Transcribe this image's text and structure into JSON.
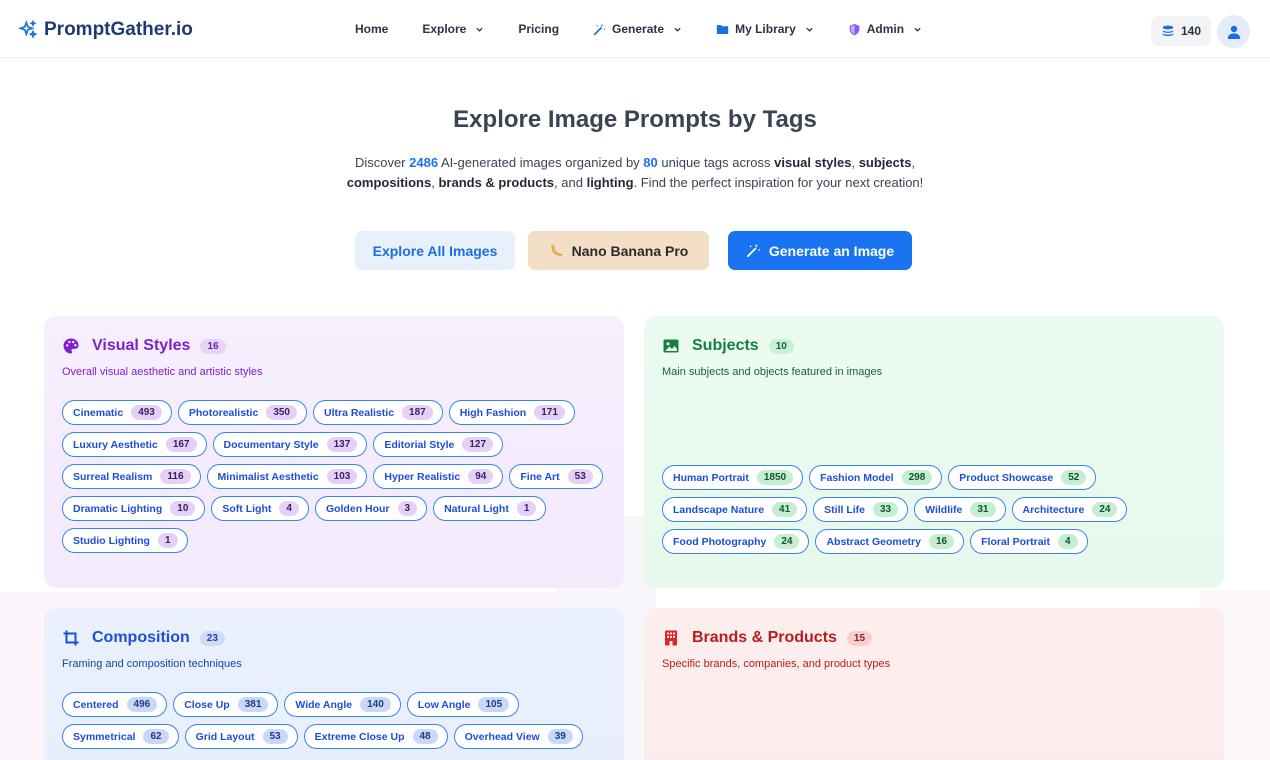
{
  "nav": {
    "logo": "PromptGather.io",
    "items": [
      {
        "label": "Home",
        "icon": "",
        "dropdown": false
      },
      {
        "label": "Explore",
        "icon": "",
        "dropdown": true
      },
      {
        "label": "Pricing",
        "icon": "",
        "dropdown": false
      },
      {
        "label": "Generate",
        "icon": "magic-wand-icon",
        "dropdown": true
      },
      {
        "label": "My Library",
        "icon": "folder-icon",
        "dropdown": true
      },
      {
        "label": "Admin",
        "icon": "shield-icon",
        "dropdown": true
      }
    ],
    "credits": "140"
  },
  "hero": {
    "title": "Explore Image Prompts by Tags",
    "desc": {
      "p1": "Discover ",
      "images_count": "2486",
      "p2": " AI-generated images organized by ",
      "tags_count": "80",
      "p3": " unique tags across ",
      "b1": "visual styles",
      "p4": ", ",
      "b2": "subjects",
      "p5": ",",
      "b3": "compositions",
      "p6": ", ",
      "b4": "brands & products",
      "p7": ", and ",
      "b5": "lighting",
      "p8": ". Find the perfect inspiration for your next creation!"
    },
    "buttons": {
      "explore": "Explore All Images",
      "banana": "Nano Banana Pro",
      "generate": "Generate an Image"
    }
  },
  "categories": {
    "visual": {
      "title": "Visual Styles",
      "count": "16",
      "desc": "Overall visual aesthetic and artistic styles",
      "icon": "palette-icon",
      "tags": [
        {
          "label": "Cinematic",
          "count": "493"
        },
        {
          "label": "Photorealistic",
          "count": "350"
        },
        {
          "label": "Ultra Realistic",
          "count": "187"
        },
        {
          "label": "High Fashion",
          "count": "171"
        },
        {
          "label": "Luxury Aesthetic",
          "count": "167"
        },
        {
          "label": "Documentary Style",
          "count": "137"
        },
        {
          "label": "Editorial Style",
          "count": "127"
        },
        {
          "label": "Surreal Realism",
          "count": "116"
        },
        {
          "label": "Minimalist Aesthetic",
          "count": "103"
        },
        {
          "label": "Hyper Realistic",
          "count": "94"
        },
        {
          "label": "Fine Art",
          "count": "53"
        },
        {
          "label": "Dramatic Lighting",
          "count": "10"
        },
        {
          "label": "Soft Light",
          "count": "4"
        },
        {
          "label": "Golden Hour",
          "count": "3"
        },
        {
          "label": "Natural Light",
          "count": "1"
        },
        {
          "label": "Studio Lighting",
          "count": "1"
        }
      ]
    },
    "subjects": {
      "title": "Subjects",
      "count": "10",
      "desc": "Main subjects and objects featured in images",
      "icon": "image-icon",
      "tags": [
        {
          "label": "Human Portrait",
          "count": "1850"
        },
        {
          "label": "Fashion Model",
          "count": "298"
        },
        {
          "label": "Product Showcase",
          "count": "52"
        },
        {
          "label": "Landscape Nature",
          "count": "41"
        },
        {
          "label": "Still Life",
          "count": "33"
        },
        {
          "label": "Wildlife",
          "count": "31"
        },
        {
          "label": "Architecture",
          "count": "24"
        },
        {
          "label": "Food Photography",
          "count": "24"
        },
        {
          "label": "Abstract Geometry",
          "count": "16"
        },
        {
          "label": "Floral Portrait",
          "count": "4"
        }
      ]
    },
    "composition": {
      "title": "Composition",
      "count": "23",
      "desc": "Framing and composition techniques",
      "icon": "crop-icon",
      "tags": [
        {
          "label": "Centered",
          "count": "496"
        },
        {
          "label": "Close Up",
          "count": "381"
        },
        {
          "label": "Wide Angle",
          "count": "140"
        },
        {
          "label": "Low Angle",
          "count": "105"
        },
        {
          "label": "Symmetrical",
          "count": "62"
        },
        {
          "label": "Grid Layout",
          "count": "53"
        },
        {
          "label": "Extreme Close Up",
          "count": "48"
        },
        {
          "label": "Overhead View",
          "count": "39"
        }
      ]
    },
    "brands": {
      "title": "Brands & Products",
      "count": "15",
      "desc": "Specific brands, companies, and product types",
      "icon": "building-icon",
      "tags": []
    }
  }
}
